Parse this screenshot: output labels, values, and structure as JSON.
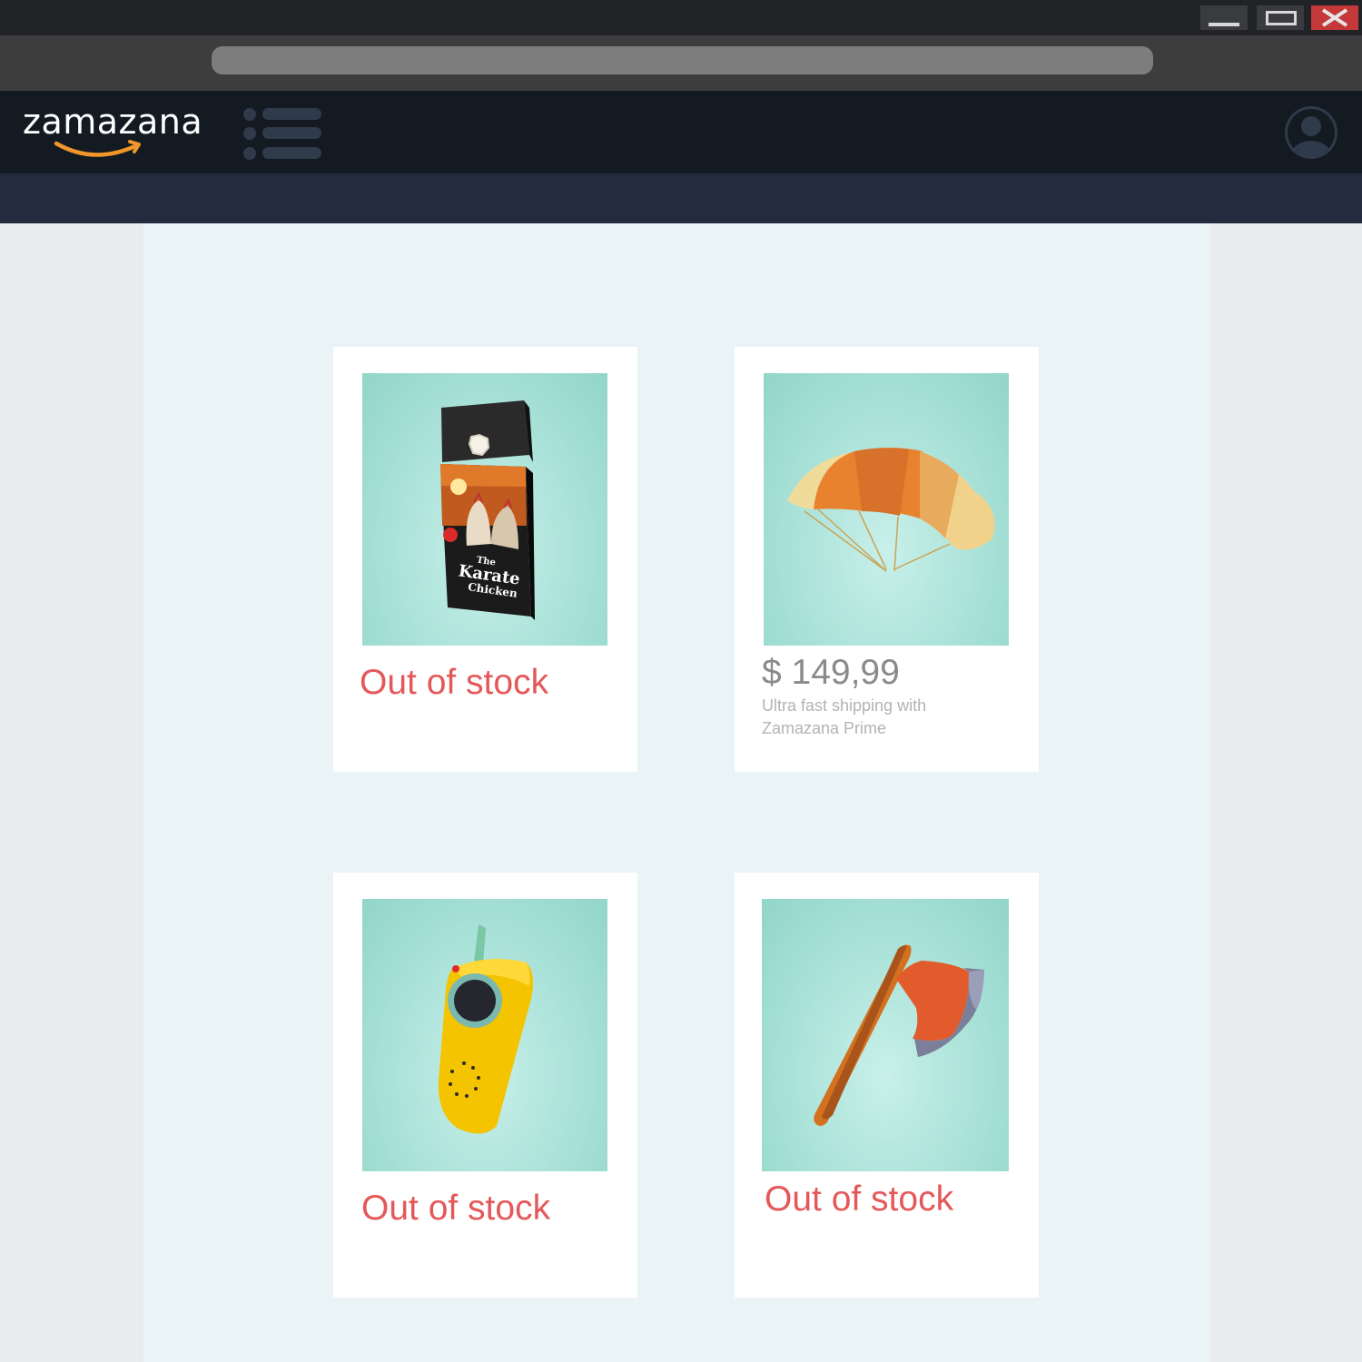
{
  "window": {
    "controls": [
      "minimize-icon",
      "maximize-icon",
      "close-icon"
    ]
  },
  "navbar": {
    "logo": "zamazana",
    "menu_icon": "list-menu-icon",
    "account_icon": "user-account-icon"
  },
  "products": [
    {
      "item": "The Karate Chicken DVD",
      "cover_line1": "The",
      "cover_line2": "Karate",
      "cover_line3": "Chicken",
      "status": "Out of stock"
    },
    {
      "item": "Parachute",
      "price": "$ 149,99",
      "shipping": "Ultra fast shipping with Zamazana Prime"
    },
    {
      "item": "Walkie-talkie",
      "status": "Out of stock"
    },
    {
      "item": "Axe",
      "status": "Out of stock"
    }
  ],
  "colors": {
    "titlebar": "#222327",
    "close_button": "#c4383a",
    "navbar": "#141a22",
    "subnav": "#222c3e",
    "logo_smile": "#f0962a",
    "out_of_stock": "#e5585a",
    "price": "#8a8a8a",
    "product_background": "#aee4db"
  }
}
